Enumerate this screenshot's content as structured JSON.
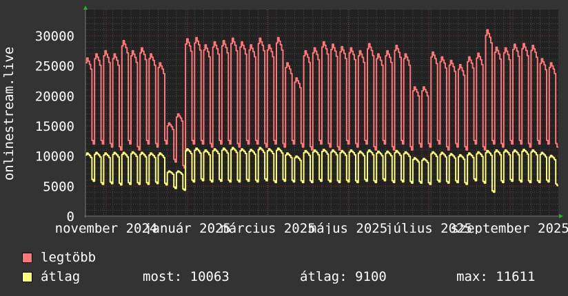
{
  "chart_data": {
    "type": "line",
    "ylabel": "onlinestream.live",
    "ylim": [
      0,
      30000
    ],
    "yticks": [
      "0",
      "5000",
      "10000",
      "15000",
      "20000",
      "25000",
      "30000"
    ],
    "ytick_values": [
      0,
      5000,
      10000,
      15000,
      20000,
      25000,
      30000
    ],
    "xticks": [
      "november 2024",
      "január 2025",
      "március 2025",
      "május 2025",
      "július 2025",
      "szeptember 2025"
    ],
    "x_unit": "week",
    "grid": true,
    "series": [
      {
        "name": "legtöbb",
        "color": "#ff7777",
        "weekly_peak": [
          26300,
          27000,
          27500,
          27000,
          29200,
          27500,
          28000,
          27000,
          25500,
          15500,
          17000,
          29500,
          29700,
          28500,
          29000,
          29200,
          29600,
          29000,
          28500,
          29600,
          28500,
          29700,
          25500,
          23000,
          27500,
          28000,
          29000,
          28600,
          28200,
          28000,
          27500,
          28700,
          27000,
          27500,
          28400,
          27000,
          21500,
          21500,
          27300,
          26500,
          25900,
          25200,
          26500,
          27100,
          31000,
          28100,
          28000,
          28600,
          28700,
          28400,
          26200,
          25500
        ],
        "weekly_trough": [
          12000,
          12000,
          11500,
          11000,
          12000,
          11000,
          12000,
          11500,
          12000,
          9000,
          8000,
          12000,
          12000,
          11500,
          12000,
          12000,
          11500,
          12000,
          12000,
          11500,
          12000,
          11500,
          12000,
          11500,
          11000,
          12000,
          11500,
          11000,
          12000,
          11500,
          12000,
          11000,
          12000,
          11000,
          12000,
          11000,
          11500,
          11500,
          12000,
          11000,
          11500,
          11000,
          12000,
          11000,
          12000,
          11500,
          12000,
          12000,
          11500,
          12000,
          12000,
          11500
        ]
      },
      {
        "name": "átlag",
        "color": "#ffff77",
        "weekly_peak": [
          10500,
          10600,
          10500,
          10600,
          10600,
          10700,
          10600,
          10500,
          10500,
          7500,
          7500,
          11200,
          11300,
          11000,
          11200,
          11300,
          11400,
          11200,
          11100,
          11400,
          11200,
          11300,
          10500,
          10000,
          10900,
          11000,
          11100,
          11000,
          10900,
          11000,
          10800,
          11000,
          10800,
          10800,
          10900,
          10700,
          9700,
          9600,
          10700,
          10600,
          10400,
          10200,
          10500,
          10700,
          10900,
          11000,
          11000,
          11000,
          11100,
          11000,
          10600,
          10100
        ],
        "weekly_trough": [
          5800,
          5300,
          5400,
          5200,
          5300,
          5300,
          5300,
          5400,
          5200,
          4600,
          4300,
          5700,
          5900,
          5700,
          5800,
          5700,
          5700,
          5800,
          5700,
          5900,
          5600,
          5800,
          5700,
          5600,
          5600,
          5800,
          5700,
          5600,
          5700,
          5600,
          5800,
          5600,
          5900,
          5600,
          5700,
          5500,
          5500,
          5300,
          5700,
          5500,
          5600,
          5300,
          5900,
          5500,
          4000,
          5600,
          5800,
          5700,
          5600,
          5600,
          5700,
          5100
        ]
      }
    ]
  },
  "legend": {
    "items": [
      {
        "label": "legtöbb",
        "color": "#ff7777"
      },
      {
        "label": "átlag",
        "color": "#ffff77"
      }
    ],
    "stats": {
      "current": "most: 10063",
      "average": "átlag: 9100",
      "max": "max: 11611"
    }
  }
}
